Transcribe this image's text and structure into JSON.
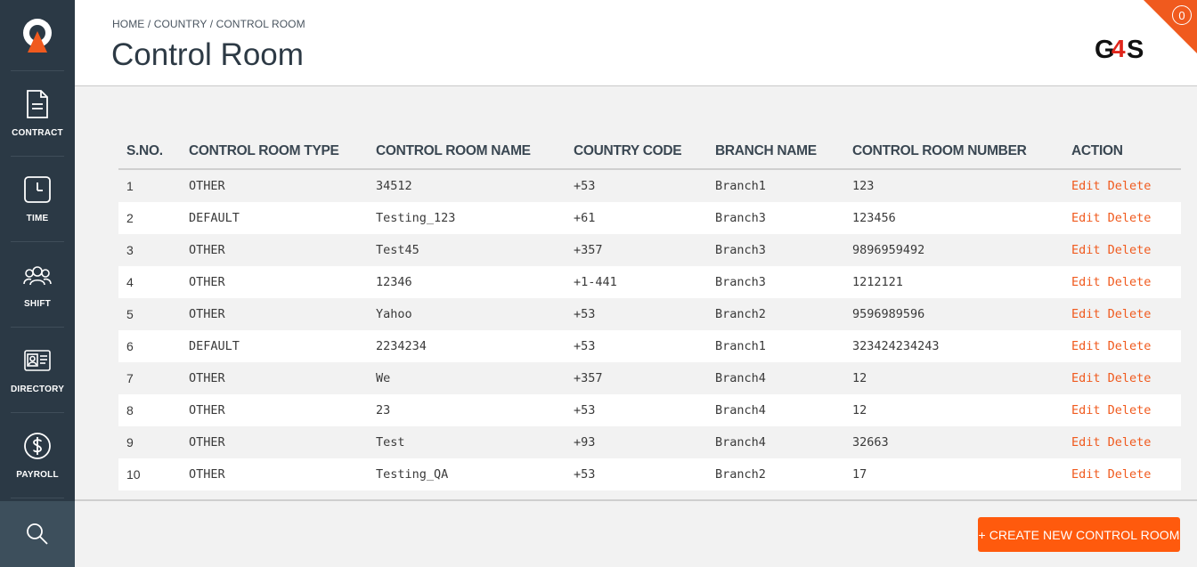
{
  "sidebar": {
    "items": [
      {
        "label": "CONTRACT",
        "icon": "document-icon"
      },
      {
        "label": "TIME",
        "icon": "clock-icon"
      },
      {
        "label": "SHIFT",
        "icon": "group-icon"
      },
      {
        "label": "DIRECTORY",
        "icon": "id-card-icon"
      },
      {
        "label": "PAYROLL",
        "icon": "dollar-icon"
      }
    ],
    "search_icon": "search-icon"
  },
  "header": {
    "breadcrumb": "HOME / COUNTRY / CONTROL ROOM",
    "title": "Control Room",
    "notification_count": "0",
    "brand": "G4S"
  },
  "table": {
    "columns": [
      "S.NO.",
      "CONTROL ROOM TYPE",
      "CONTROL ROOM NAME",
      "COUNTRY CODE",
      "BRANCH NAME",
      "CONTROL ROOM NUMBER",
      "ACTION"
    ],
    "rows": [
      {
        "sno": "1",
        "type": "OTHER",
        "name": "34512",
        "code": "+53",
        "branch": "Branch1",
        "number": "123"
      },
      {
        "sno": "2",
        "type": "DEFAULT",
        "name": "Testing_123",
        "code": "+61",
        "branch": "Branch3",
        "number": "123456"
      },
      {
        "sno": "3",
        "type": "OTHER",
        "name": "Test45",
        "code": "+357",
        "branch": "Branch3",
        "number": "9896959492"
      },
      {
        "sno": "4",
        "type": "OTHER",
        "name": "12346",
        "code": "+1-441",
        "branch": "Branch3",
        "number": "1212121"
      },
      {
        "sno": "5",
        "type": "OTHER",
        "name": "Yahoo",
        "code": "+53",
        "branch": "Branch2",
        "number": "9596989596"
      },
      {
        "sno": "6",
        "type": "DEFAULT",
        "name": "2234234",
        "code": "+53",
        "branch": "Branch1",
        "number": "323424234243"
      },
      {
        "sno": "7",
        "type": "OTHER",
        "name": "We",
        "code": "+357",
        "branch": "Branch4",
        "number": "12"
      },
      {
        "sno": "8",
        "type": "OTHER",
        "name": "23",
        "code": "+53",
        "branch": "Branch4",
        "number": "12"
      },
      {
        "sno": "9",
        "type": "OTHER",
        "name": "Test",
        "code": "+93",
        "branch": "Branch4",
        "number": "32663"
      },
      {
        "sno": "10",
        "type": "OTHER",
        "name": "Testing_QA",
        "code": "+53",
        "branch": "Branch2",
        "number": "17"
      }
    ],
    "edit_label": "Edit",
    "delete_label": "Delete"
  },
  "footer": {
    "create_label": "+ CREATE NEW CONTROL ROOM"
  },
  "colors": {
    "accent": "#ff5a0d",
    "sidebar_bg": "#2b3945",
    "title_text": "#2d3a45"
  }
}
